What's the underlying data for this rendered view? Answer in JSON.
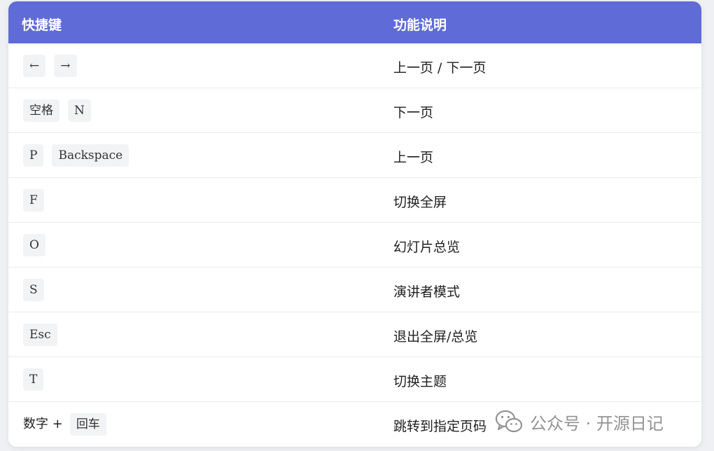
{
  "table": {
    "header": {
      "col1": "快捷键",
      "col2": "功能说明"
    },
    "rows": [
      {
        "prefix": "",
        "keys": [
          "←",
          "→"
        ],
        "desc": "上一页 / 下一页"
      },
      {
        "prefix": "",
        "keys": [
          "空格",
          "N"
        ],
        "desc": "下一页"
      },
      {
        "prefix": "",
        "keys": [
          "P",
          "Backspace"
        ],
        "desc": "上一页"
      },
      {
        "prefix": "",
        "keys": [
          "F"
        ],
        "desc": "切换全屏"
      },
      {
        "prefix": "",
        "keys": [
          "O"
        ],
        "desc": "幻灯片总览"
      },
      {
        "prefix": "",
        "keys": [
          "S"
        ],
        "desc": "演讲者模式"
      },
      {
        "prefix": "",
        "keys": [
          "Esc"
        ],
        "desc": "退出全屏/总览"
      },
      {
        "prefix": "",
        "keys": [
          "T"
        ],
        "desc": "切换主题"
      },
      {
        "prefix": "数字 +",
        "keys": [
          "回车"
        ],
        "desc": "跳转到指定页码"
      }
    ]
  },
  "watermark": {
    "text": "公众号 · 开源日记",
    "icon": "wechat-icon"
  },
  "colors": {
    "header_bg": "#5f6bd6",
    "kbd_bg": "#f1f3f5"
  }
}
